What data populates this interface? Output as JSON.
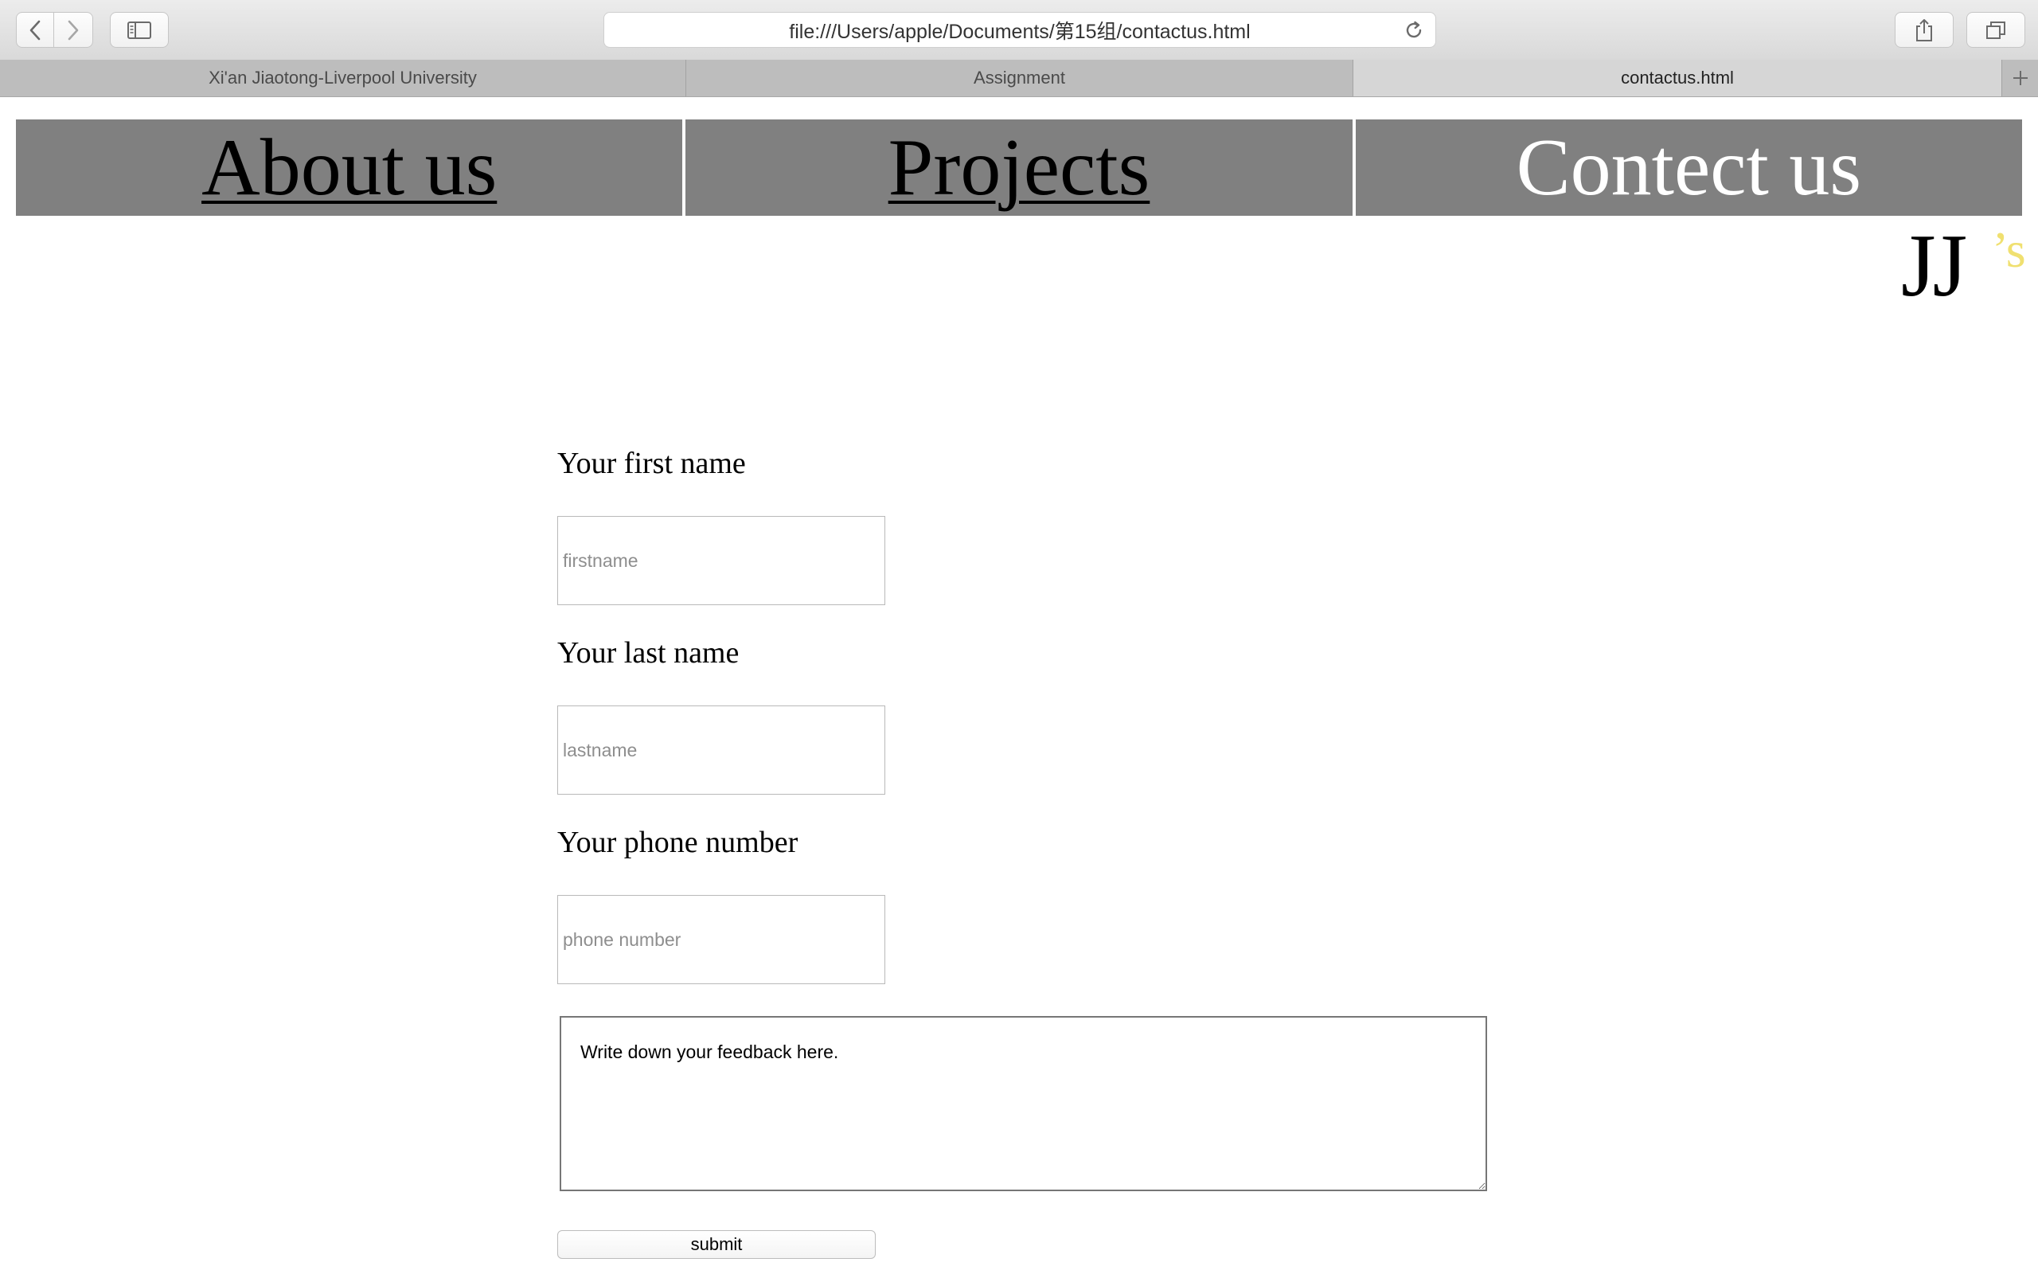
{
  "browser": {
    "url": "file:///Users/apple/Documents/第15组/contactus.html",
    "tabs": [
      {
        "label": "Xi'an Jiaotong-Liverpool University",
        "active": false
      },
      {
        "label": "Assignment",
        "active": false
      },
      {
        "label": "contactus.html",
        "active": true
      }
    ],
    "icons": [
      "back-icon",
      "forward-icon",
      "sidebar-icon",
      "reload-icon",
      "share-icon",
      "tabs-overview-icon",
      "plus-icon"
    ]
  },
  "nav": {
    "items": [
      {
        "label": "About us",
        "current": false
      },
      {
        "label": "Projects",
        "current": false
      },
      {
        "label": "Contect us",
        "current": true
      }
    ],
    "bg_color": "#808080"
  },
  "logo": {
    "main": "JJ",
    "suffix": "’s",
    "suffix_color": "#f0e070"
  },
  "form": {
    "first_name_label": "Your first name",
    "first_name_placeholder": "firstname",
    "last_name_label": "Your last name",
    "last_name_placeholder": "lastname",
    "phone_label": "Your phone number",
    "phone_placeholder": "phone number",
    "feedback_text": "Write down your feedback here.",
    "submit_label": "submit"
  }
}
